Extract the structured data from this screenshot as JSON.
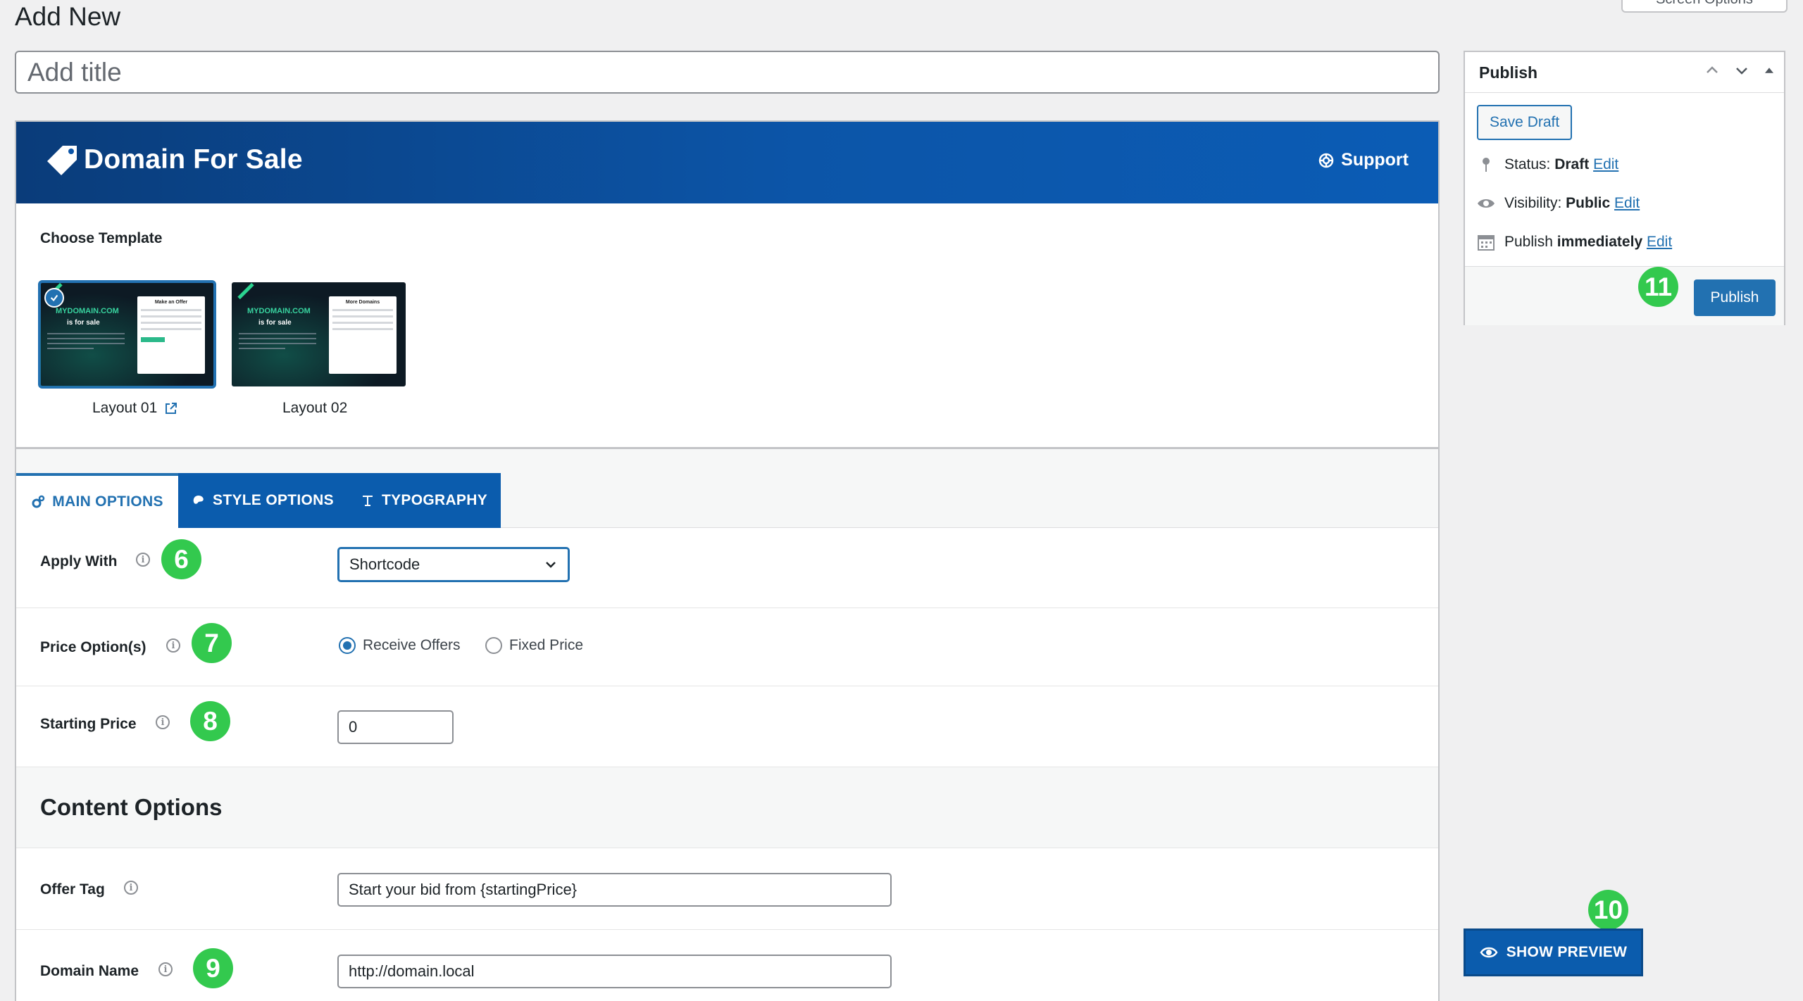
{
  "page": {
    "title": "Add New",
    "screen_options_label": "Screen Options"
  },
  "title_field": {
    "placeholder": "Add title",
    "value": ""
  },
  "plugin": {
    "name": "Domain For Sale",
    "support_label": "Support",
    "choose_template_label": "Choose Template",
    "templates": [
      {
        "label": "Layout 01",
        "selected": true,
        "brand": "MYDOMAIN.COM",
        "sale": "is for sale",
        "card_title": "Make an Offer"
      },
      {
        "label": "Layout 02",
        "selected": false,
        "brand": "MYDOMAIN.COM",
        "sale": "is for sale",
        "card_title": "More Domains"
      }
    ],
    "tabs": [
      {
        "label": "MAIN OPTIONS",
        "active": true,
        "icon": "gears-icon"
      },
      {
        "label": "STYLE OPTIONS",
        "active": false,
        "icon": "palette-icon"
      },
      {
        "label": "TYPOGRAPHY",
        "active": false,
        "icon": "text-icon"
      }
    ],
    "fields": {
      "apply_with": {
        "label": "Apply With",
        "value": "Shortcode",
        "badge": "6"
      },
      "price_options": {
        "label": "Price Option(s)",
        "badge": "7",
        "options": [
          "Receive Offers",
          "Fixed Price"
        ],
        "selected": "Receive Offers"
      },
      "starting_price": {
        "label": "Starting Price",
        "value": "0",
        "badge": "8"
      },
      "content_options_title": "Content Options",
      "offer_tag": {
        "label": "Offer Tag",
        "value": "Start your bid from {startingPrice}"
      },
      "domain_name": {
        "label": "Domain Name",
        "value": "http://domain.local",
        "badge": "9"
      }
    }
  },
  "publish": {
    "title": "Publish",
    "save_draft_label": "Save Draft",
    "status_label": "Status:",
    "status_value": "Draft",
    "visibility_label": "Visibility:",
    "visibility_value": "Public",
    "publish_label": "Publish",
    "publish_value": "immediately",
    "edit_label": "Edit",
    "publish_button": "Publish",
    "badge": "11"
  },
  "preview": {
    "label": "SHOW PREVIEW",
    "badge": "10"
  },
  "colors": {
    "accent": "#2271b1",
    "header_blue": "#0c55a8",
    "badge_green": "#33c94e"
  }
}
